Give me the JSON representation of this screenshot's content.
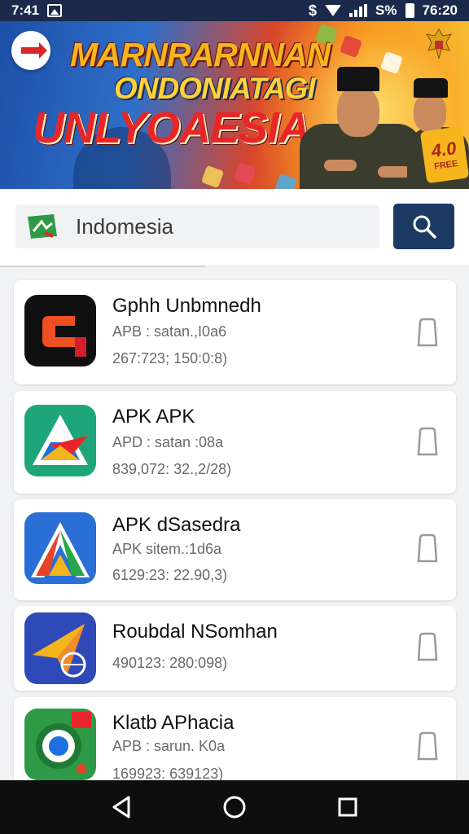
{
  "status_bar": {
    "time": "7:41",
    "battery": "S%",
    "clock": "76:20"
  },
  "banner": {
    "line1": "MARNRARNNAN",
    "line2": "ONDONIATAGI",
    "line3": "UNLYOAESIA",
    "badge_top": "4.0",
    "badge_bottom": "FREE"
  },
  "search": {
    "value": "Indomesia"
  },
  "apps": [
    {
      "name": "Gphh Unbmnedh",
      "line1": "APB : satan.,I0a6",
      "line2": "267:723; 150:0:8)"
    },
    {
      "name": "APK APK",
      "line1": "APD : satan :08a",
      "line2": "839,072: 32.,2/28)"
    },
    {
      "name": "APK dSasedra",
      "line1": "APK sitem.:1d6a",
      "line2": "6129:23: 22.90,3)"
    },
    {
      "name": "Roubdal NSomhan",
      "line1": "",
      "line2": "490123: 280:098)"
    },
    {
      "name": "Klatb APhacia",
      "line1": "APB : sarun. K0a",
      "line2": "169923: 639123)"
    }
  ],
  "colors": {
    "status_bar": "#1b2a4a",
    "search_button": "#1d3a64",
    "nav_bar": "#0e0e0e"
  }
}
